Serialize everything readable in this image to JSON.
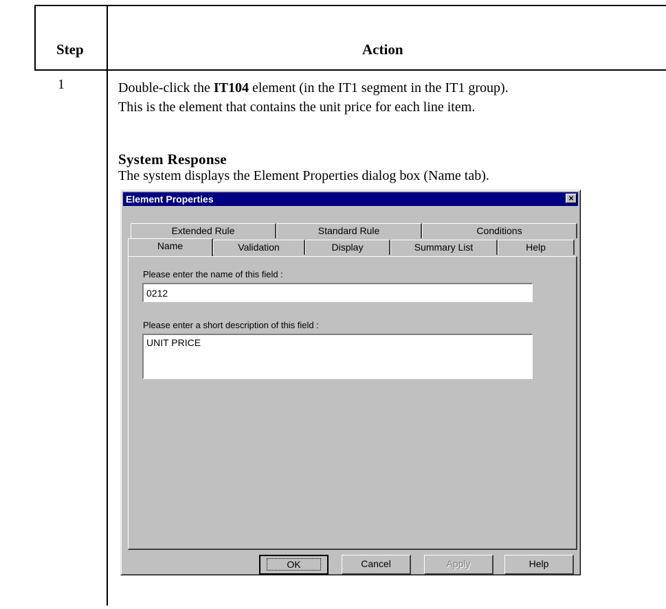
{
  "table": {
    "step_header": "Step",
    "action_header": "Action",
    "step_number": "1",
    "para1_line1_pre": "Double-click the ",
    "para1_line1_bold": "IT104",
    "para1_line1_post": " element (in the IT1 segment in the IT1 group).",
    "para1_line2": "This is the element that contains the unit price for each line item.",
    "system_response_heading": "System Response",
    "system_response_text": "The system displays the Element Properties dialog box (Name tab)."
  },
  "dialog": {
    "title": "Element Properties",
    "close_glyph": "×",
    "tabs_back": [
      "Extended Rule",
      "Standard Rule",
      "Conditions"
    ],
    "tabs_front": [
      "Name",
      "Validation",
      "Display",
      "Summary List",
      "Help"
    ],
    "active_tab": "Name",
    "name_label": "Please enter the name of this field :",
    "name_value": "0212",
    "description_label": "Please enter a short description of this field :",
    "description_value": "UNIT PRICE",
    "buttons": {
      "ok": "OK",
      "cancel": "Cancel",
      "apply": "Apply",
      "help": "Help"
    }
  }
}
